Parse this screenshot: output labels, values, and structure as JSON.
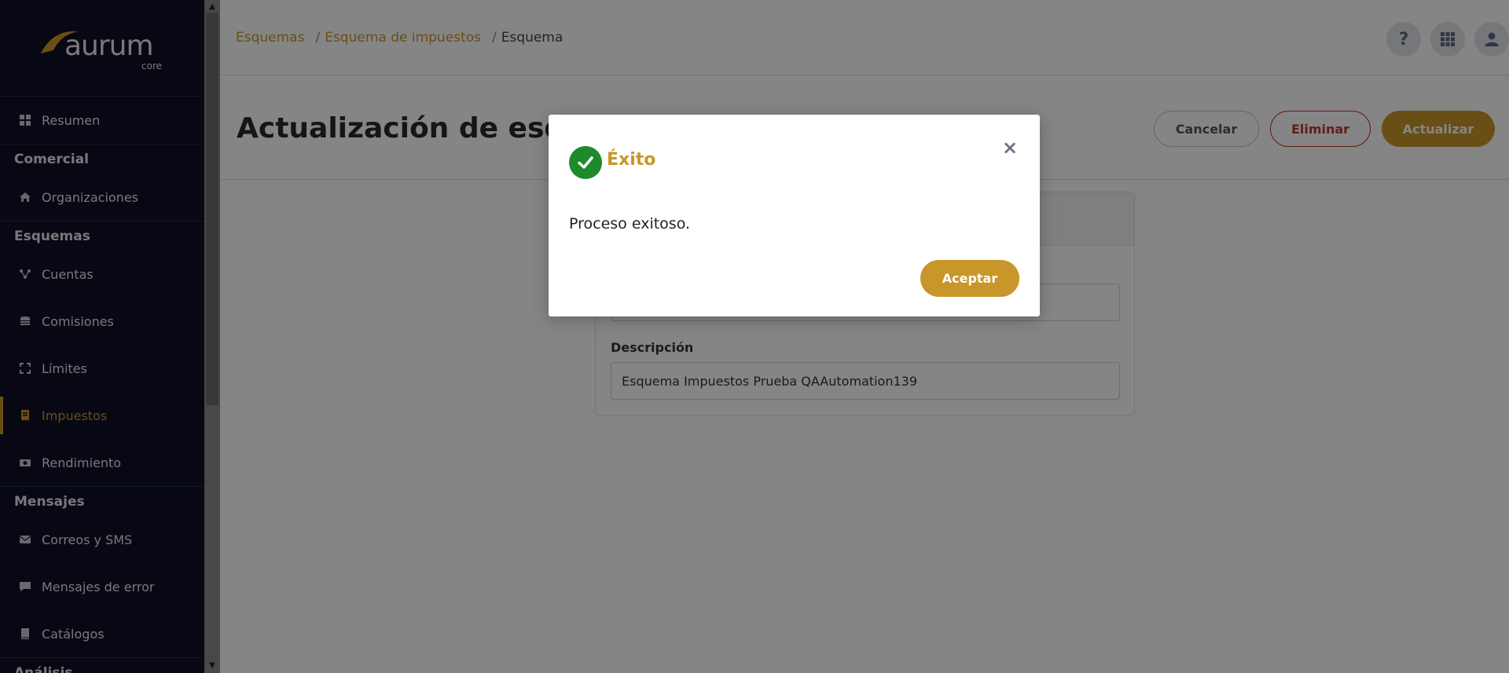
{
  "brand": {
    "name": "aurum",
    "sub": "core",
    "accent": "#c9962a"
  },
  "sidebar": {
    "items": [
      {
        "label": "Resumen",
        "icon": "dashboard-icon"
      },
      {
        "section": "Comercial"
      },
      {
        "label": "Organizaciones",
        "icon": "home-icon"
      },
      {
        "section": "Esquemas"
      },
      {
        "label": "Cuentas",
        "icon": "network-icon"
      },
      {
        "label": "Comisiones",
        "icon": "coins-icon"
      },
      {
        "label": "Límites",
        "icon": "expand-icon"
      },
      {
        "label": "Impuestos",
        "icon": "receipt-icon",
        "active": true
      },
      {
        "label": "Rendimiento",
        "icon": "money-icon"
      },
      {
        "section": "Mensajes"
      },
      {
        "label": "Correos y SMS",
        "icon": "envelope-icon"
      },
      {
        "label": "Mensajes de error",
        "icon": "comment-icon"
      },
      {
        "label": "Catálogos",
        "icon": "book-icon"
      },
      {
        "section": "Análisis"
      }
    ]
  },
  "breadcrumb": {
    "items": [
      "Esquemas",
      "Esquema de impuestos",
      "Esquema"
    ]
  },
  "header": {
    "title": "Actualización de esquema",
    "cancel_label": "Cancelar",
    "delete_label": "Eliminar",
    "update_label": "Actualizar"
  },
  "form": {
    "description_label": "Descripción",
    "description_value": "Esquema Impuestos Prueba QAAutomation139"
  },
  "modal": {
    "title": "Éxito",
    "message": "Proceso exitoso.",
    "accept_label": "Aceptar",
    "close_symbol": "×"
  }
}
